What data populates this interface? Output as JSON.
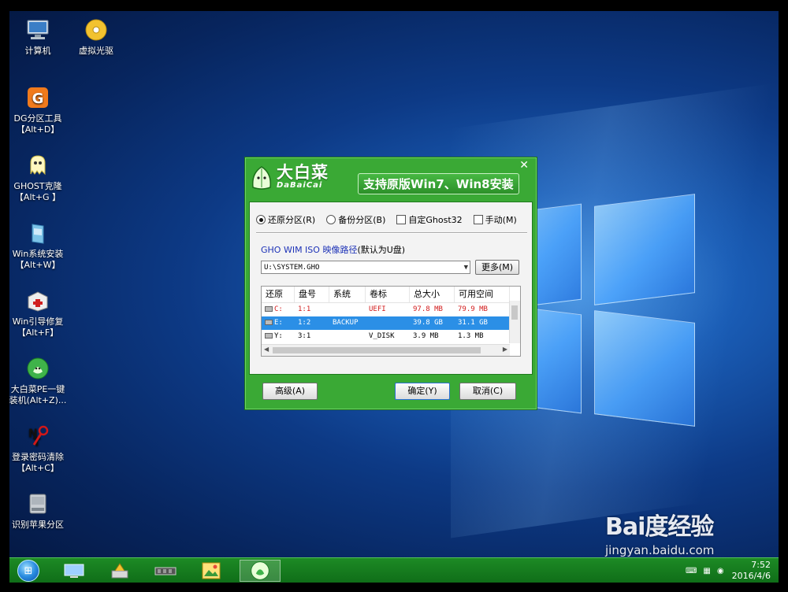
{
  "desktop": {
    "icons": [
      {
        "label": "计算机",
        "icon": "computer-icon"
      },
      {
        "label": "虚拟光驱",
        "icon": "virtual-drive-icon"
      },
      {
        "label": "DG分区工具\n【Alt+D】",
        "icon": "diskgenius-icon"
      },
      {
        "label": "GHOST克隆\n【Alt+G 】",
        "icon": "ghost-icon"
      },
      {
        "label": "Win系统安装\n【Alt+W】",
        "icon": "win-install-icon"
      },
      {
        "label": "Win引导修复\n【Alt+F】",
        "icon": "boot-repair-icon"
      },
      {
        "label": "大白菜PE一键\n装机(Alt+Z)...",
        "icon": "dabaicai-icon"
      },
      {
        "label": "登录密码清除\n【Alt+C】",
        "icon": "password-clear-icon"
      },
      {
        "label": "识别苹果分区",
        "icon": "apple-partition-icon"
      }
    ]
  },
  "dialog": {
    "brand_cn": "大白菜",
    "brand_en": "DaBaiCai",
    "slogan": "支持原版Win7、Win8安装",
    "close": "✕",
    "options": [
      {
        "type": "radio",
        "label": "还原分区(R)",
        "checked": true
      },
      {
        "type": "radio",
        "label": "备份分区(B)",
        "checked": false
      },
      {
        "type": "checkbox",
        "label": "自定Ghost32",
        "checked": false
      },
      {
        "type": "checkbox",
        "label": "手动(M)",
        "checked": false
      }
    ],
    "path_label": "GHO WIM ISO 映像路径",
    "path_hint": "(默认为U盘)",
    "path_value": "U:\\SYSTEM.GHO",
    "more_button": "更多(M)",
    "table": {
      "columns": [
        "还原",
        "盘号",
        "系统",
        "卷标",
        "总大小",
        "可用空间"
      ],
      "rows": [
        {
          "drive": "C:",
          "disk": "1:1",
          "system": "",
          "label": "UEFI",
          "total": "97.8 MB",
          "free": "79.9 MB",
          "red": true,
          "selected": false
        },
        {
          "drive": "E:",
          "disk": "1:2",
          "system": "BACKUP",
          "label": "",
          "total": "39.8 GB",
          "free": "31.1 GB",
          "red": false,
          "selected": true
        },
        {
          "drive": "Y:",
          "disk": "3:1",
          "system": "",
          "label": "V_DISK",
          "total": "3.9 MB",
          "free": "1.3 MB",
          "red": false,
          "selected": false
        }
      ]
    },
    "advanced_button": "高级(A)",
    "ok_button": "确定(Y)",
    "cancel_button": "取消(C)"
  },
  "taskbar": {
    "items": [
      "monitor-icon",
      "tools-icon",
      "memory-icon",
      "photo-icon",
      "dabaicai-icon"
    ],
    "active_index": 4,
    "clock_time": "7:52",
    "clock_date": "2016/4/6"
  },
  "watermark": {
    "logo": "Bai度经验",
    "url": "jingyan.baidu.com"
  }
}
